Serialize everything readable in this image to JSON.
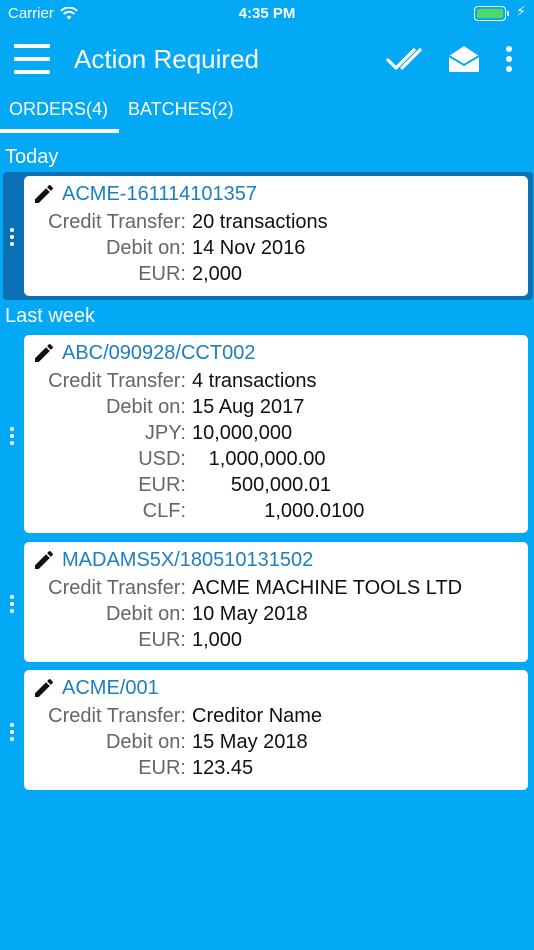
{
  "status_bar": {
    "carrier": "Carrier",
    "time": "4:35 PM",
    "battery_level": 1.0
  },
  "app_bar": {
    "title": "Action Required"
  },
  "tabs": [
    {
      "label": "ORDERS(4)",
      "active": true
    },
    {
      "label": "BATCHES(2)",
      "active": false
    }
  ],
  "sections": {
    "today": "Today",
    "last_week": "Last week"
  },
  "cards": [
    {
      "ref": "ACME-161114101357",
      "rows": [
        {
          "label": "Credit Transfer:",
          "value": "20 transactions"
        },
        {
          "label": "Debit on:",
          "value": "14 Nov 2016"
        },
        {
          "label": "EUR:",
          "value": "2,000"
        }
      ]
    },
    {
      "ref": "ABC/090928/CCT002",
      "rows": [
        {
          "label": "Credit Transfer:",
          "value": "4 transactions"
        },
        {
          "label": "Debit on:",
          "value": "15 Aug 2017"
        },
        {
          "label": "JPY:",
          "value": "10,000,000"
        },
        {
          "label": "USD:",
          "value": "   1,000,000.00"
        },
        {
          "label": "EUR:",
          "value": "       500,000.01"
        },
        {
          "label": "CLF:",
          "value": "             1,000.0100"
        }
      ]
    },
    {
      "ref": "MADAMS5X/180510131502",
      "rows": [
        {
          "label": "Credit Transfer:",
          "value": "ACME MACHINE TOOLS LTD"
        },
        {
          "label": "Debit on:",
          "value": "10 May 2018"
        },
        {
          "label": "EUR:",
          "value": "1,000"
        }
      ]
    },
    {
      "ref": "ACME/001",
      "rows": [
        {
          "label": "Credit Transfer:",
          "value": "Creditor Name"
        },
        {
          "label": "Debit on:",
          "value": "15 May 2018"
        },
        {
          "label": "EUR:",
          "value": "123.45"
        }
      ]
    }
  ],
  "colors": {
    "background": "#03a9f4",
    "selected": "#0b6fb4",
    "ref_link": "#1a7fc4"
  },
  "icons": [
    "wifi-icon",
    "battery-icon",
    "menu-icon",
    "double-check-icon",
    "open-envelope-icon",
    "more-vert-icon",
    "pencil-icon",
    "drag-handle-icon"
  ]
}
